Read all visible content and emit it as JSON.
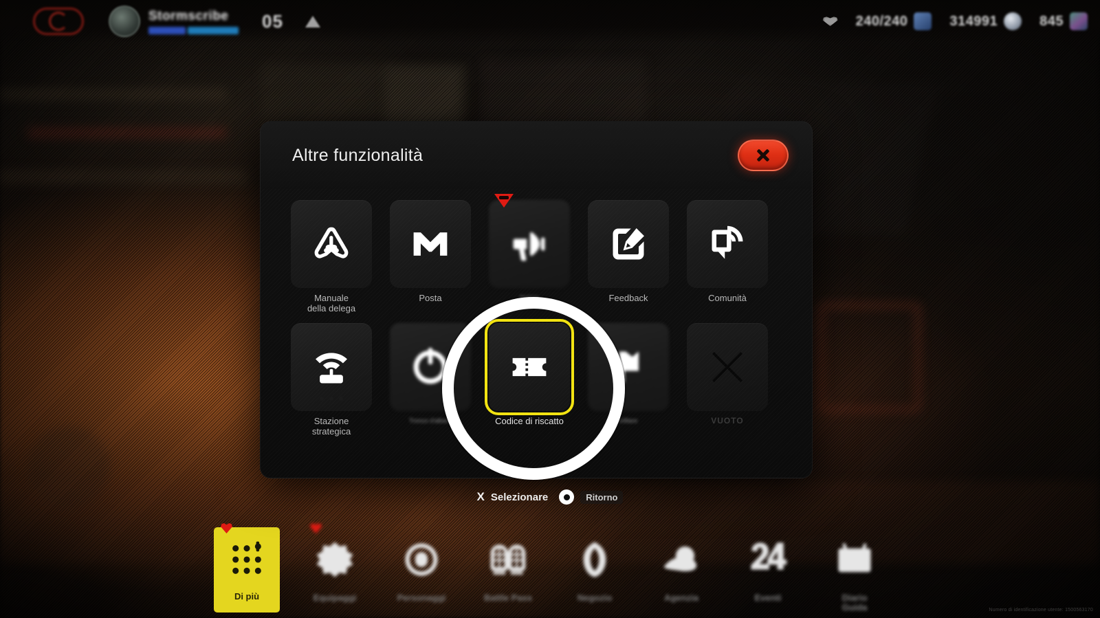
{
  "hud": {
    "logo_icon": "game-logo-icon",
    "player_name": "Stormscribe",
    "level": "05",
    "alert_icon": "warning-triangle-icon",
    "heart_icon": "heart-icon",
    "resources": [
      {
        "icon": "stamina-icon",
        "prefix": "",
        "value": "240/240"
      },
      {
        "icon": "coin-icon",
        "prefix": "",
        "value": "314991"
      },
      {
        "icon": "gem-icon",
        "prefix": "",
        "value": "845"
      }
    ]
  },
  "modal": {
    "title": "Altre funzionalità",
    "close_icon": "close-icon",
    "rows": [
      [
        {
          "id": "manuale-della-delega",
          "label": "Manuale\ndella delega",
          "icon": "pen-nib-triangle-icon",
          "state": "normal",
          "badge": false
        },
        {
          "id": "posta",
          "label": "Posta",
          "icon": "mail-m-icon",
          "state": "normal",
          "badge": false
        },
        {
          "id": "notizie",
          "label": "Notizie",
          "icon": "megaphone-icon",
          "state": "blurred",
          "badge": true
        },
        {
          "id": "feedback",
          "label": "Feedback",
          "icon": "edit-pencil-icon",
          "state": "normal",
          "badge": false
        },
        {
          "id": "comunita",
          "label": "Comunità",
          "icon": "community-chat-icon",
          "state": "normal",
          "badge": false
        }
      ],
      [
        {
          "id": "stazione-strategica",
          "label": "Stazione\nstrategica",
          "icon": "router-wifi-icon",
          "state": "normal",
          "badge": false
        },
        {
          "id": "tronco-dalbero",
          "label": "Tronco d'albero",
          "icon": "power-ring-icon",
          "state": "blurred",
          "badge": false
        },
        {
          "id": "codice-di-riscatto",
          "label": "Codice di riscatto",
          "icon": "ticket-star-icon",
          "state": "selected",
          "badge": false
        },
        {
          "id": "infilare",
          "label": "infilare",
          "icon": "flag-icon",
          "state": "blurred",
          "badge": false
        },
        {
          "id": "vuoto",
          "label": "VUOTO",
          "icon": "empty-x-icon",
          "state": "dim",
          "badge": false
        }
      ]
    ]
  },
  "hints": {
    "select_button": "X",
    "select_label": "Selezionare",
    "back_button_icon": "circle-button-icon",
    "back_label": "Ritorno"
  },
  "bottom_nav": [
    {
      "id": "di-piu",
      "label": "Di più",
      "icon": "grid-dots-icon",
      "active": true,
      "badge": true
    },
    {
      "id": "nav-2",
      "label": "Equipaggi",
      "icon": "gear-moon-icon",
      "active": false,
      "badge": true
    },
    {
      "id": "nav-3",
      "label": "Personaggi",
      "icon": "capsule-ring-icon",
      "active": false,
      "badge": false
    },
    {
      "id": "nav-4",
      "label": "Battle Pass",
      "icon": "globe-pair-icon",
      "active": false,
      "badge": false
    },
    {
      "id": "nav-5",
      "label": "Negozio",
      "icon": "leaf-shield-icon",
      "active": false,
      "badge": false
    },
    {
      "id": "nav-6",
      "label": "Agenzia",
      "icon": "planet-icon",
      "active": false,
      "badge": false
    },
    {
      "id": "nav-7",
      "label": "Eventi",
      "icon": "number-24-icon",
      "active": false,
      "badge": false
    },
    {
      "id": "nav-8",
      "label": "Diario\nGuida",
      "icon": "tv-color-icon",
      "active": false,
      "badge": false
    }
  ],
  "watermark": "Numero di identificazione utente: 1500563170"
}
